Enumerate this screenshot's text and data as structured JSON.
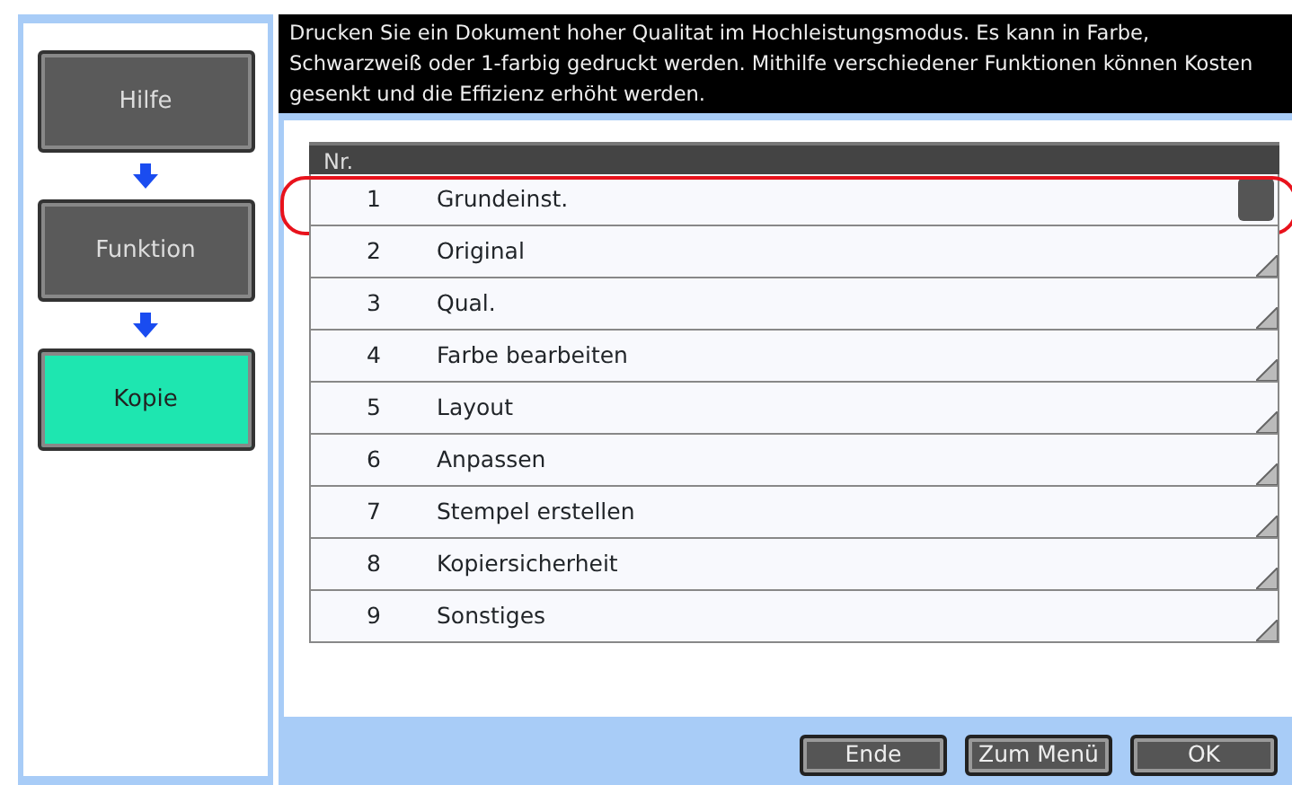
{
  "sidebar": {
    "items": [
      {
        "label": "Hilfe",
        "selected": false
      },
      {
        "label": "Funktion",
        "selected": false
      },
      {
        "label": "Kopie",
        "selected": true
      }
    ]
  },
  "message": "Drucken Sie ein Dokument hoher Qualitat im Hochleistungsmodus. Es kann in Farbe, Schwarzweiß oder 1-farbig gedruckt werden. Mithilfe verschiedener Funktionen können Kosten gesenkt und die Effizienz erhöht werden.",
  "table": {
    "columns": [
      "Nr."
    ],
    "rows": [
      {
        "number": "1",
        "label": "Grundeinst.",
        "highlighted": true
      },
      {
        "number": "2",
        "label": "Original",
        "highlighted": false
      },
      {
        "number": "3",
        "label": "Qual.",
        "highlighted": false
      },
      {
        "number": "4",
        "label": "Farbe bearbeiten",
        "highlighted": false
      },
      {
        "number": "5",
        "label": "Layout",
        "highlighted": false
      },
      {
        "number": "6",
        "label": "Anpassen",
        "highlighted": false
      },
      {
        "number": "7",
        "label": "Stempel erstellen",
        "highlighted": false
      },
      {
        "number": "8",
        "label": "Kopiersicherheit",
        "highlighted": false
      },
      {
        "number": "9",
        "label": "Sonstiges",
        "highlighted": false
      }
    ]
  },
  "buttons": [
    "Ende",
    "Zum Menü",
    "OK"
  ]
}
